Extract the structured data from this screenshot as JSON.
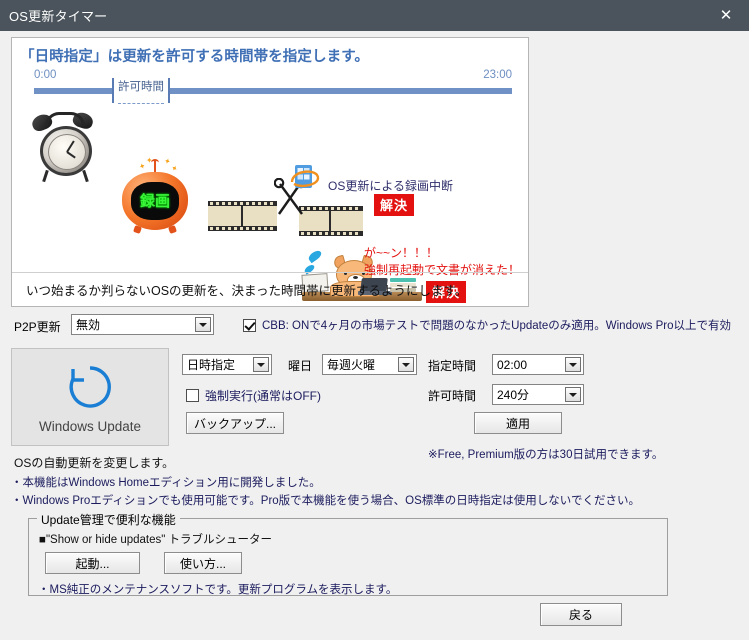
{
  "window": {
    "title": "OS更新タイマー",
    "close_icon": "close-icon",
    "titlebar_color": "#4b545c"
  },
  "illustration": {
    "heading": "「日時指定」は更新を許可する時間帯を指定します。",
    "timeline": {
      "start_label": "0:00",
      "end_label": "23:00",
      "segment_label": "許可時間",
      "bar_color": "#6f91c6"
    },
    "annotations": {
      "recording_label": "録画",
      "interrupt_text": "OS更新による録画中断",
      "solved_badge_1": "解決",
      "shock_line1": "が~~ン！！！",
      "shock_line2": "強制再起動で文書が消えた！",
      "solved_badge_2": "解決",
      "badge_color": "#e3110f"
    },
    "footer": "いつ始まるか判らないOSの更新を、決まった時間帯に更新するようにします。"
  },
  "p2p_row": {
    "label": "P2P更新",
    "value": "無効",
    "cbb": {
      "checked": true,
      "text": "CBB: ONで4ヶ月の市場テストで問題のなかったUpdateのみ適用。Windows Pro以上で有効"
    }
  },
  "windows_update": {
    "icon": "refresh-circle-icon",
    "label": "Windows Update",
    "icon_color": "#1a7fd4"
  },
  "settings": {
    "mode_value": "日時指定",
    "weekday_label": "曜日",
    "weekday_value": "毎週火曜",
    "time_label": "指定時間",
    "time_value": "02:00",
    "duration_label": "許可時間",
    "duration_value": "240分",
    "force_checkbox": {
      "checked": false,
      "label": "強制実行(通常はOFF)"
    },
    "backup_button": "バックアップ...",
    "apply_button": "適用",
    "trial_note": "※Free, Premium版の方は30日試用できます。"
  },
  "description": {
    "line1": "OSの自動更新を変更します。",
    "line2": "・本機能はWindows Homeエディション用に開発しました。",
    "line3": "・Windows Proエディションでも使用可能です。Pro版で本機能を使う場合、OS標準の日時指定は使用しないでください。"
  },
  "groupbox": {
    "caption": "Update管理で便利な機能",
    "item": "■\"Show or hide updates\" トラブルシューター",
    "launch_button": "起動...",
    "howto_button": "使い方...",
    "note": "・MS純正のメンテナンスソフトです。更新プログラムを表示します。"
  },
  "footer": {
    "back_button": "戻る"
  }
}
